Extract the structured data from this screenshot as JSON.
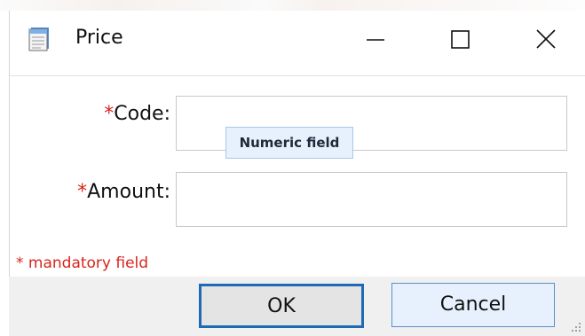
{
  "window": {
    "title": "Price",
    "icon": "notepad-icon",
    "controls": [
      "minimize-icon",
      "maximize-icon",
      "close-icon"
    ]
  },
  "form": {
    "required_marker": "*",
    "code": {
      "label": "Code:",
      "value": "",
      "tooltip": "Numeric field"
    },
    "amount": {
      "label": "Amount:",
      "value": ""
    },
    "mandatory_note": "* mandatory field"
  },
  "buttons": {
    "ok": "OK",
    "cancel": "Cancel"
  },
  "colors": {
    "required": "#d9231d",
    "accent": "#1e6ab5",
    "tooltip_bg": "#e7f1fd"
  }
}
